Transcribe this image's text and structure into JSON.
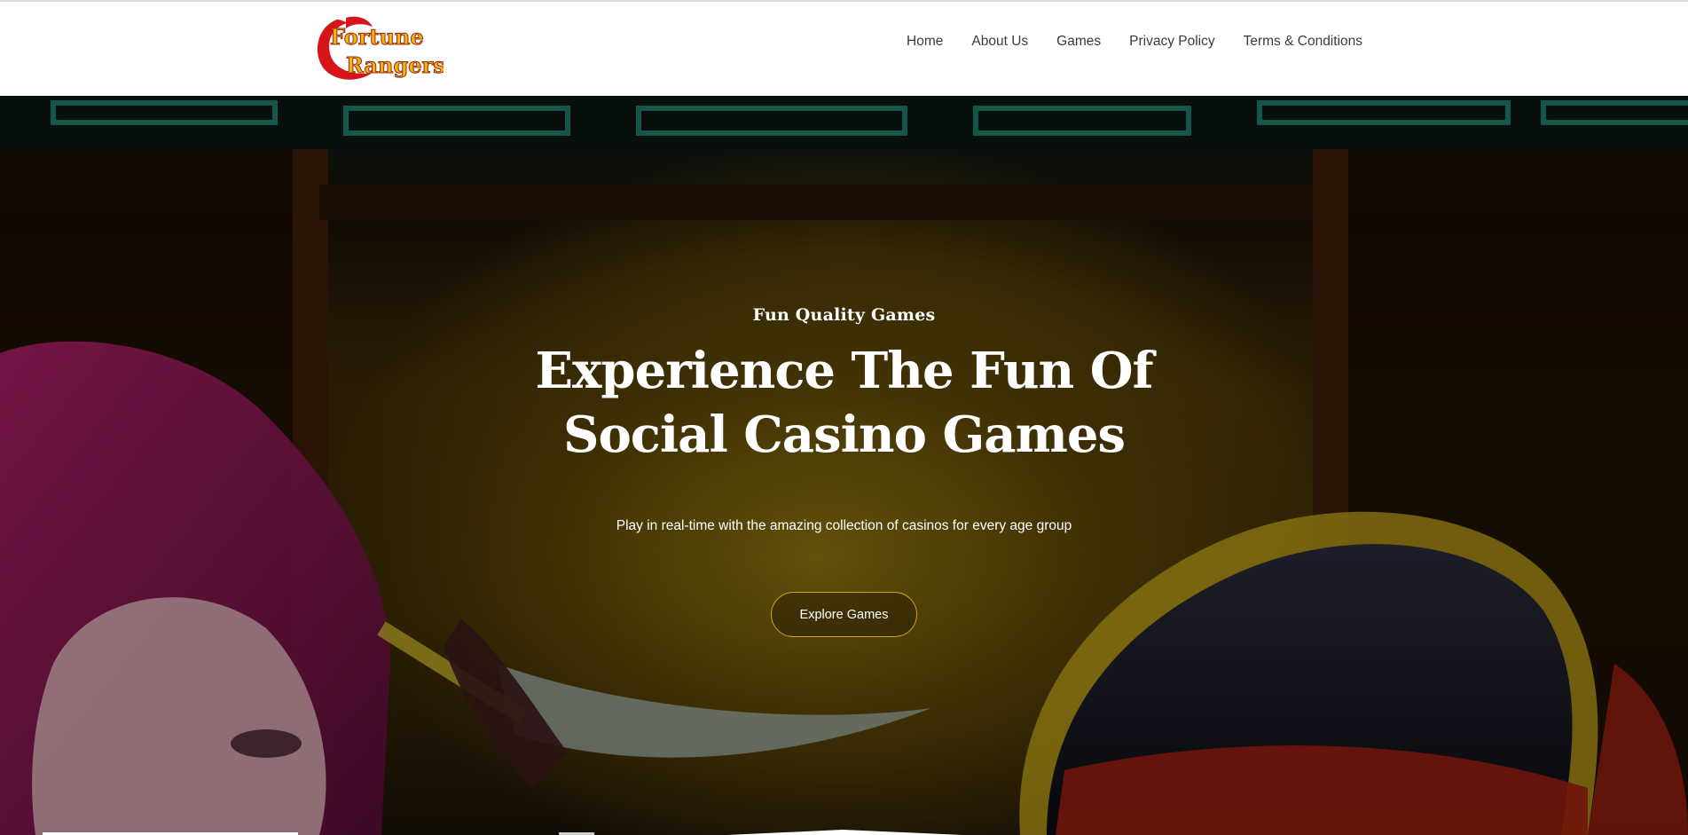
{
  "header": {
    "logo": {
      "line1": "Fortune",
      "line2": "Rangers"
    },
    "nav": [
      {
        "label": "Home"
      },
      {
        "label": "About Us"
      },
      {
        "label": "Games"
      },
      {
        "label": "Privacy Policy"
      },
      {
        "label": "Terms & Conditions"
      }
    ]
  },
  "hero": {
    "eyebrow": "Fun Quality Games",
    "headline_line1": "Experience The Fun Of",
    "headline_line2": "Social Casino Games",
    "subtext": "Play in real-time with the amazing collection of casinos for every age group",
    "cta_label": "Explore Games"
  },
  "colors": {
    "cta_border": "#d4a51a",
    "logo_red": "#d8141b",
    "logo_gold": "#f2b21a",
    "header_bg": "#ffffff",
    "nav_text": "#3b3b3b"
  }
}
